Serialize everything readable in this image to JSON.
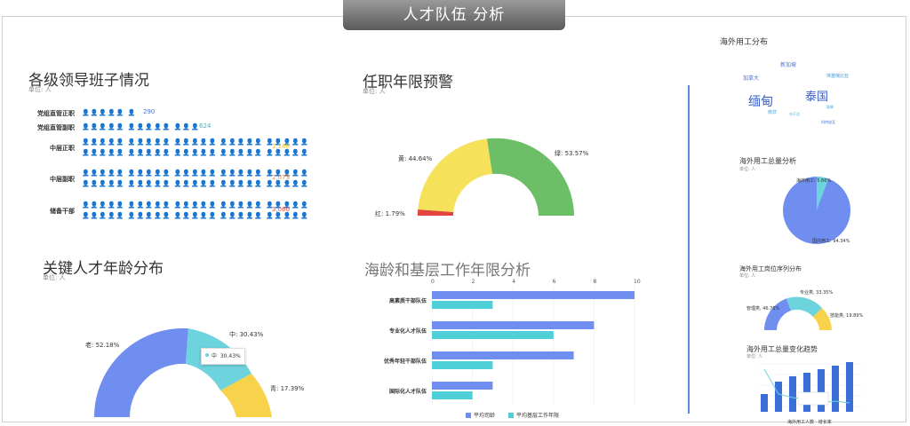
{
  "header": {
    "title": "人才队伍 分析"
  },
  "leaders": {
    "title": "各级领导班子情况",
    "unit": "单位: 人",
    "rows": [
      {
        "label": "党组直管正职",
        "icons": "👤👤👤👤👤 👤",
        "value": "290",
        "color": "#4a6fd8"
      },
      {
        "label": "党组直管副职",
        "icons": "👤👤👤👤👤 👤👤👤👤👤 👤👤👤",
        "value": "624",
        "color": "#36b6c9"
      },
      {
        "label": "中层正职",
        "icons": "👤👤👤👤👤 👤👤👤👤👤 👤👤👤👤👤 👤👤👤👤👤 👤👤👤👤👤",
        "value": "1,188",
        "color": "#f2c233"
      },
      {
        "label": "中层副职",
        "icons": "👤👤👤👤👤 👤👤👤👤👤 👤👤👤👤👤 👤👤👤👤👤 👤👤👤👤👤",
        "value": "2,073",
        "color": "#ef8a33"
      },
      {
        "label": "储备干部",
        "icons": "👤👤👤👤👤 👤👤👤👤👤 👤👤👤👤👤 👤👤👤👤👤 👤👤👤👤👤",
        "value": "3,060",
        "color": "#e55151"
      }
    ]
  },
  "tenure": {
    "title": "任职年限预警",
    "unit": "单位: 人",
    "labels": {
      "green": "绿: 53.57%",
      "yellow": "黄: 44.64%",
      "red": "红: 1.79%"
    },
    "colors": {
      "green": "#6cbf66",
      "yellow": "#f6e15a",
      "red": "#e2453c"
    }
  },
  "age": {
    "title": "关键人才年龄分布",
    "unit": "单位: 人",
    "labels": {
      "old": "老: 52.18%",
      "mid": "中: 30.43%",
      "young": "青: 17.39%"
    },
    "tooltip": {
      "name": "中",
      "value": "30.43%"
    },
    "colors": {
      "old": "#6f8ef0",
      "mid": "#6dd3dc",
      "young": "#f8d24a"
    }
  },
  "seniority": {
    "title": "海龄和基层工作年限分析",
    "axis": [
      "0",
      "2",
      "4",
      "6",
      "8",
      "10"
    ],
    "categories": [
      "高素质干部队伍",
      "专业化人才队伍",
      "优秀年轻干部队伍",
      "国际化人才队伍"
    ],
    "legend": [
      "平均司龄",
      "平均基层工作年限"
    ],
    "colors": {
      "a": "#6f8ef0",
      "b": "#4fd0d8"
    }
  },
  "chart_data": {
    "type": "bar",
    "categories": [
      "高素质干部队伍",
      "专业化人才队伍",
      "优秀年轻干部队伍",
      "国际化人才队伍"
    ],
    "series": [
      {
        "name": "平均司龄",
        "values": [
          10,
          8,
          7,
          3
        ]
      },
      {
        "name": "平均基层工作年限",
        "values": [
          3,
          6,
          3,
          2
        ]
      }
    ],
    "title": "海龄和基层工作年限分析",
    "xlim": [
      0,
      10
    ]
  },
  "overseas": {
    "title": "海外用工分布",
    "words": [
      {
        "text": "新加坡",
        "size": 6,
        "color": "#4a6fd8"
      },
      {
        "text": "加拿大",
        "size": 6,
        "color": "#4a6fd8"
      },
      {
        "text": "缅甸",
        "size": 14,
        "color": "#3a5fc8"
      },
      {
        "text": "泰国",
        "size": 13,
        "color": "#3a5fc8"
      },
      {
        "text": "埃塞俄比亚",
        "size": 5,
        "color": "#4a9fd8"
      },
      {
        "text": "南非",
        "size": 5,
        "color": "#4a9fd8"
      },
      {
        "text": "乌干达",
        "size": 4,
        "color": "#4aa8d8"
      },
      {
        "text": "刚果",
        "size": 4,
        "color": "#4aa8d8"
      },
      {
        "text": "科特迪瓦",
        "size": 4,
        "color": "#4a6fd8"
      }
    ],
    "total_title": "海外用工总量分析",
    "total_unit": "单位: 人",
    "pie_labels": [
      "海外用工: 5.66%",
      "国内用工: 94.34%"
    ],
    "seq_title": "海外用工岗位序列分布",
    "seq_unit": "单位: 人",
    "seq_labels": [
      "管理类, 46.76%",
      "专业类, 33.35%",
      "技能类, 19.89%"
    ],
    "trend_title": "海外用工总量变化趋势",
    "trend_unit": "单位: 人",
    "trend_legend": [
      "海外用工人数",
      "增长率"
    ]
  }
}
